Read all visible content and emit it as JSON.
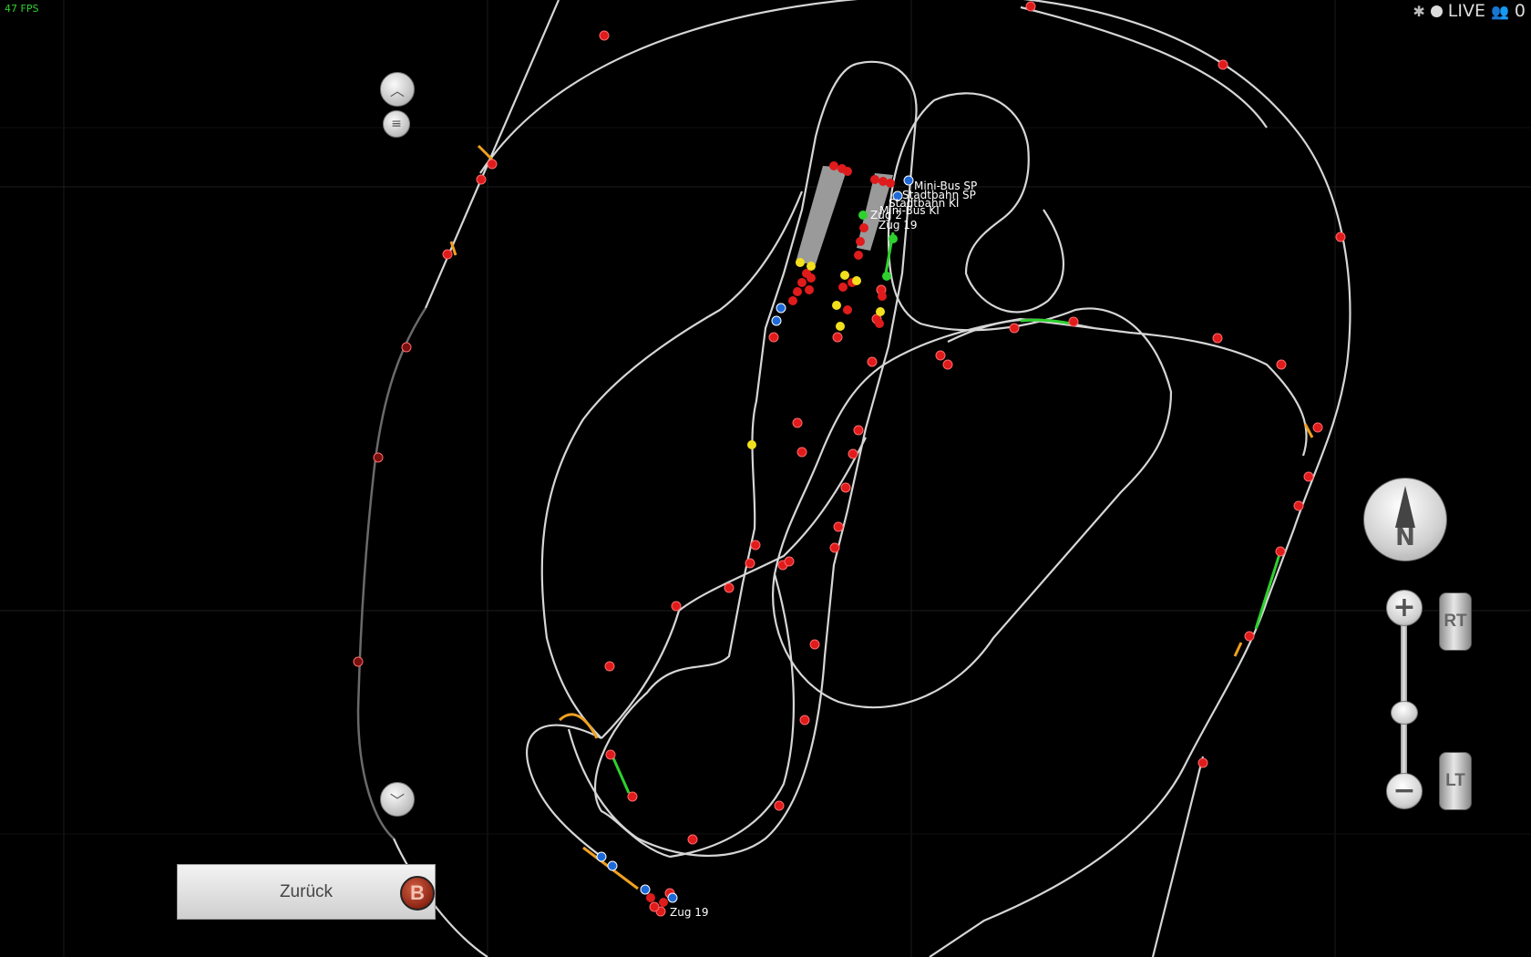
{
  "hud": {
    "fps": "47 FPS",
    "live_label": "LIVE",
    "player_count": "0",
    "icons": {
      "debug": "bug-icon",
      "live": "live-dot-icon",
      "players": "players-icon"
    }
  },
  "map": {
    "train_labels": [
      "Mini-Bus SP",
      "Stadtbahn SP",
      "Stadtbahn KI",
      "Mini-Bus KI",
      "Zug 2",
      "Zug 19",
      "Zug 19"
    ],
    "colors": {
      "track": "#d6d6d6",
      "track_dim": "#6a6a6a",
      "signal": "#e01b1b",
      "occupied": "#2ed12e",
      "reserved": "#f0a020",
      "train_yellow": "#f2e01e",
      "station": "#9a9a9a",
      "grid": "#1c1c1c"
    }
  },
  "controls": {
    "scroll_up_icon": "chevron-up-icon",
    "menu_icon": "menu-lines-icon",
    "scroll_down_icon": "chevron-down-icon",
    "back_button_label": "Zurück",
    "back_button_badge": "B",
    "compass_label": "N",
    "zoom_in_symbol": "+",
    "zoom_out_symbol": "−",
    "rt_label": "RT",
    "lt_label": "LT"
  }
}
